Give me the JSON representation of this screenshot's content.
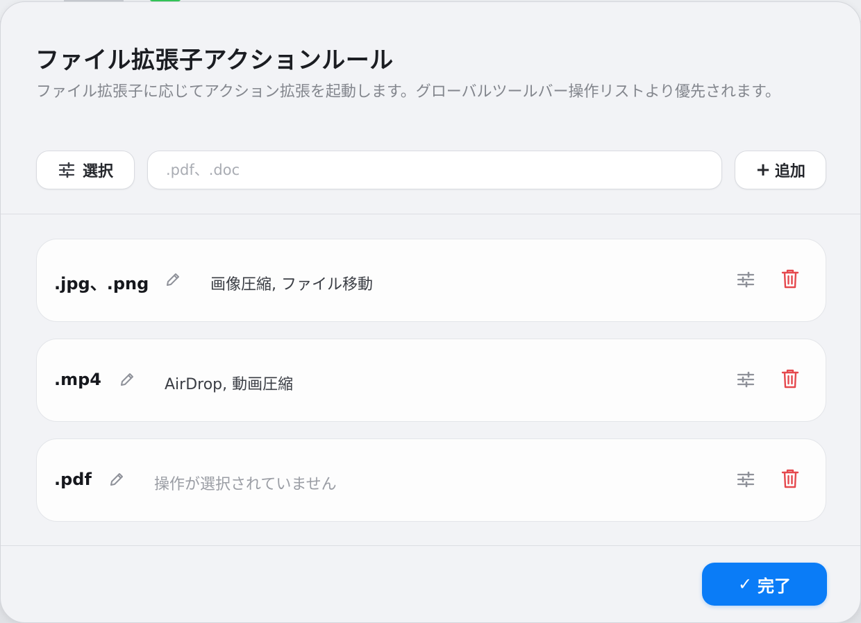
{
  "dialog": {
    "title": "ファイル拡張子アクションルール",
    "subtitle": "ファイル拡張子に応じてアクション拡張を起動します。グローバルツールバー操作リストより優先されます。"
  },
  "toolbar": {
    "pick_label": "選択",
    "input_placeholder": ".pdf、.doc",
    "input_value": "",
    "add_label": "追加",
    "add_symbol": "+"
  },
  "rules": [
    {
      "extensions": ".jpg、.png",
      "actions": "画像圧縮, ファイル移動",
      "has_actions": true
    },
    {
      "extensions": ".mp4",
      "actions": "AirDrop, 動画圧縮",
      "has_actions": true
    },
    {
      "extensions": ".pdf",
      "actions": "操作が選択されていません",
      "has_actions": false
    }
  ],
  "footer": {
    "done_label": "完了",
    "done_symbol": "✓"
  },
  "colors": {
    "accent": "#0a7cf7",
    "danger": "#e5484d",
    "icon_gray": "#8e9199"
  },
  "icons": [
    "sliders-icon",
    "pencil-icon",
    "trash-icon",
    "plus-icon",
    "checkmark-icon"
  ]
}
